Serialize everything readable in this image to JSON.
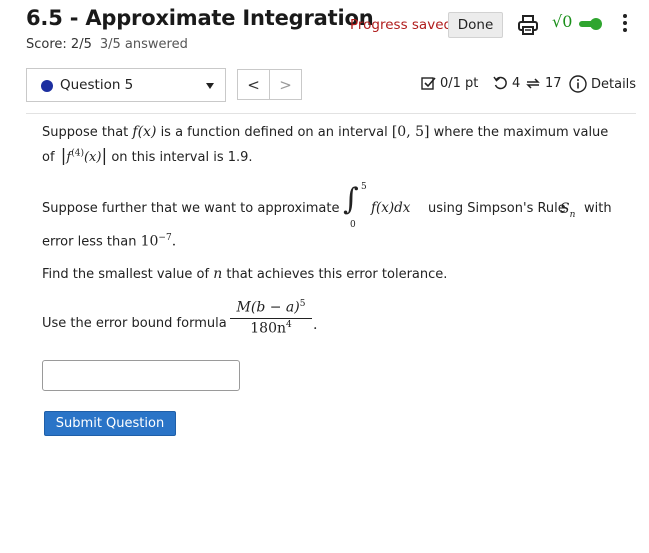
{
  "header": {
    "title": "6.5 - Approximate Integration",
    "score": "Score: 2/5",
    "answered": "3/5 answered",
    "progress_saved": "Progress saved",
    "done_label": "Done"
  },
  "question_nav": {
    "selected_question": "Question 5",
    "prev_symbol": "<",
    "next_symbol": ">"
  },
  "meta": {
    "points": "0/1 pt",
    "retries": "4",
    "attempts": "17",
    "details_label": "Details"
  },
  "question": {
    "p1_a": "Suppose that",
    "p1_fx": "f(x)",
    "p1_b": "is a function defined on an interval",
    "p1_interval": "[0, 5]",
    "p1_c": "where the maximum value",
    "p2_of": "of",
    "p2_deriv": "f",
    "p2_deriv_sup": "(4)",
    "p2_deriv_arg": "(x)",
    "p2_b": "on this interval is 1.9.",
    "p3_a": "Suppose further that we want to approximate",
    "int_upper": "5",
    "int_lower": "0",
    "int_expr": "f(x)dx",
    "p3_b": "using Simpson's Rule",
    "sn_S": "S",
    "sn_n": "n",
    "p3_c": "with",
    "p4_a": "error less than",
    "p4_base": "10",
    "p4_exp": "−7",
    "p4_period": ".",
    "p5_a": "Find the smallest value of",
    "p5_n": "n",
    "p5_b": "that achieves this error tolerance.",
    "p6_a": "Use the error bound formula",
    "frac_num": "M(b − a)",
    "frac_num_exp": "5",
    "frac_den": "180n",
    "frac_den_exp": "4",
    "frac_period": "."
  },
  "answer": {
    "value": ""
  },
  "submit_label": "Submit Question",
  "colors": {
    "progress_text": "#b01c1c",
    "submit_bg": "#2a74c7",
    "toggle_green": "#2fa52f",
    "question_dot": "#1d2fa0"
  }
}
